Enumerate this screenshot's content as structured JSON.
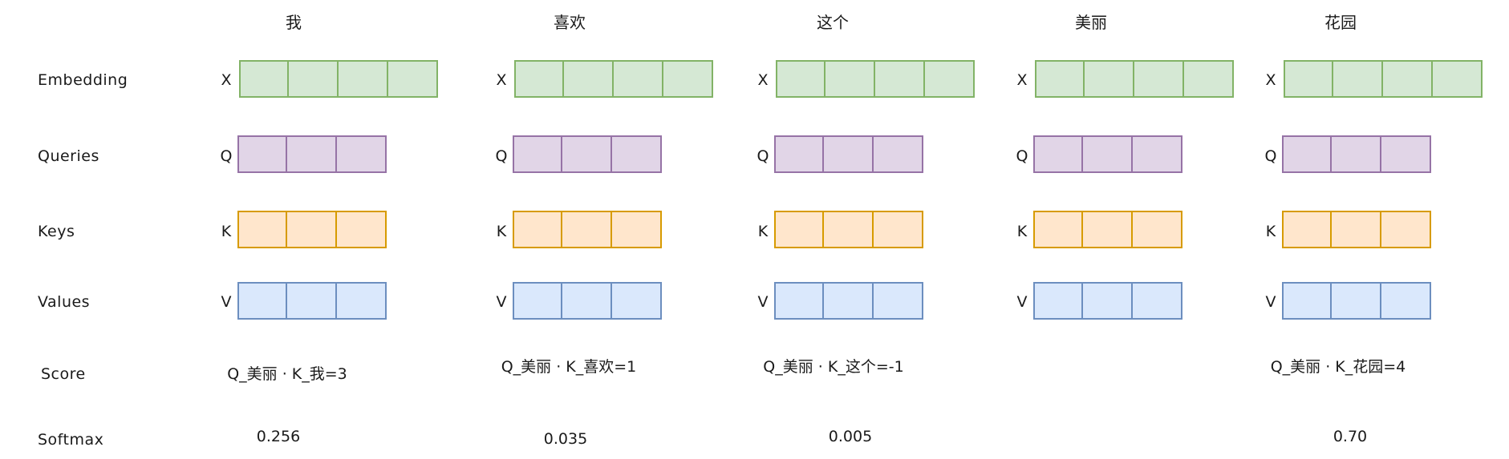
{
  "row_labels": {
    "embedding": "Embedding",
    "queries": "Queries",
    "keys": "Keys",
    "values": "Values",
    "score": "Score",
    "softmax": "Softmax"
  },
  "vector_letters": {
    "x": "X",
    "q": "Q",
    "k": "K",
    "v": "V"
  },
  "tokens": [
    {
      "word": "我",
      "embedding_dims": 4,
      "qkv_dims": 3,
      "score": "Q_美丽 · K_我=3",
      "softmax": "0.256"
    },
    {
      "word": "喜欢",
      "embedding_dims": 4,
      "qkv_dims": 3,
      "score": "Q_美丽 · K_喜欢=1",
      "softmax": "0.035"
    },
    {
      "word": "这个",
      "embedding_dims": 4,
      "qkv_dims": 3,
      "score": "Q_美丽 · K_这个=-1",
      "softmax": "0.005"
    },
    {
      "word": "美丽",
      "embedding_dims": 4,
      "qkv_dims": 3,
      "score": "",
      "softmax": ""
    },
    {
      "word": "花园",
      "embedding_dims": 4,
      "qkv_dims": 3,
      "score": "Q_美丽 · K_花园=4",
      "softmax": "0.70"
    }
  ],
  "colors": {
    "embedding_fill": "#d5e8d4",
    "embedding_stroke": "#82b366",
    "queries_fill": "#e1d5e7",
    "queries_stroke": "#9673a6",
    "keys_fill": "#ffe6cc",
    "keys_stroke": "#d79b00",
    "values_fill": "#dae8fc",
    "values_stroke": "#6c8ebf"
  }
}
